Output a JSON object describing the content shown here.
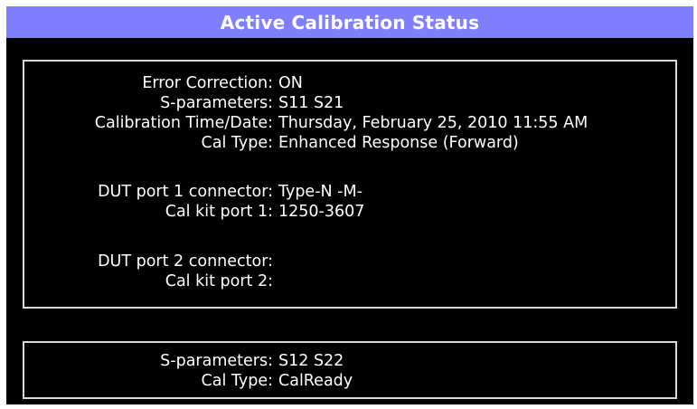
{
  "title": "Active Calibration Status",
  "panel1": {
    "rows": [
      {
        "label": "Error Correction:",
        "value": "ON"
      },
      {
        "label": "S-parameters:",
        "value": "S11 S21"
      },
      {
        "label": "Calibration Time/Date:",
        "value": "Thursday, February 25, 2010 11:55 AM"
      },
      {
        "label": "Cal Type:",
        "value": "Enhanced Response (Forward)"
      },
      {
        "label": "DUT port 1 connector:",
        "value": "Type-N -M-"
      },
      {
        "label": "Cal kit port 1:",
        "value": "1250-3607"
      },
      {
        "label": "DUT port 2 connector:",
        "value": ""
      },
      {
        "label": "Cal kit port 2:",
        "value": ""
      }
    ]
  },
  "panel2": {
    "rows": [
      {
        "label": "S-parameters:",
        "value": "S12 S22"
      },
      {
        "label": "Cal Type:",
        "value": "CalReady"
      }
    ]
  },
  "colors": {
    "title_bar": "#8080ff",
    "background": "#000000",
    "text": "#ffffff",
    "border": "#d8d8d8"
  }
}
